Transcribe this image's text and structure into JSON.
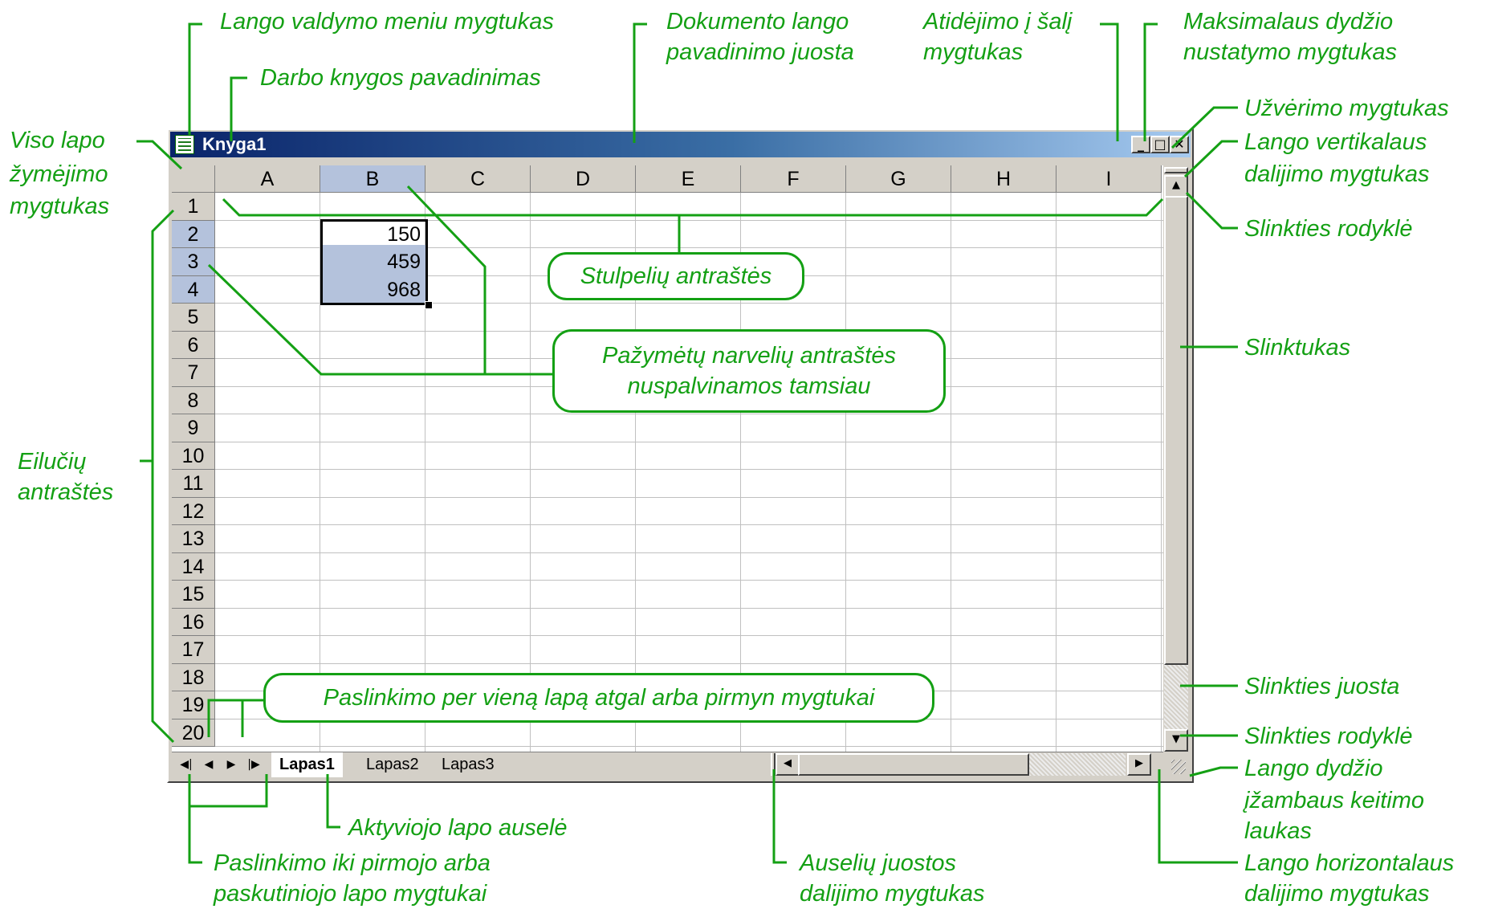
{
  "window": {
    "title": "Knyga1",
    "minimize_glyph": "_",
    "maximize_glyph": "□",
    "close_glyph": "✕"
  },
  "grid": {
    "columns": [
      "A",
      "B",
      "C",
      "D",
      "E",
      "F",
      "G",
      "H",
      "I"
    ],
    "selected_column": "B",
    "rows": [
      "1",
      "2",
      "3",
      "4",
      "5",
      "6",
      "7",
      "8",
      "9",
      "10",
      "11",
      "12",
      "13",
      "14",
      "15",
      "16",
      "17",
      "18",
      "19",
      "20"
    ],
    "selected_rows": [
      "2",
      "3",
      "4"
    ],
    "cells": [
      {
        "col": "B",
        "row": "2",
        "value": "150"
      },
      {
        "col": "B",
        "row": "3",
        "value": "459"
      },
      {
        "col": "B",
        "row": "4",
        "value": "968"
      }
    ]
  },
  "sheets": {
    "tabs": [
      "Lapas1",
      "Lapas2",
      "Lapas3"
    ],
    "active": "Lapas1",
    "nav": {
      "first": "◀|",
      "prev": "◀",
      "next": "▶",
      "last": "|▶"
    }
  },
  "scroll": {
    "up": "▲",
    "down": "▼",
    "left": "◀",
    "right": "▶"
  },
  "annotations": {
    "window_menu_button": "Lango valdymo meniu mygtukas",
    "workbook_name": "Darbo knygos pavadinimas",
    "doc_title_bar": [
      "Dokumento lango",
      "pavadinimo juosta"
    ],
    "minimize_button": [
      "Atidėjimo į šalį",
      "mygtukas"
    ],
    "maximize_button": [
      "Maksimalaus dydžio",
      "nustatymo mygtukas"
    ],
    "close_button": "Užvėrimo mygtukas",
    "vsplit_button": [
      "Lango vertikalaus",
      "dalijimo mygtukas"
    ],
    "scroll_arrow_top": "Slinkties rodyklė",
    "select_all": [
      "Viso lapo",
      "žymėjimo",
      "mygtukas"
    ],
    "column_headers": "Stulpelių antraštės",
    "selected_headers": [
      "Pažymėtų narvelių antraštės",
      "nuspalvinamos tamsiau"
    ],
    "scroll_thumb": "Slinktukas",
    "row_headers": [
      "Eilučių",
      "antraštės"
    ],
    "scroll_bar": "Slinkties juosta",
    "nav_one_sheet": "Paslinkimo per vieną lapą atgal arba pirmyn mygtukai",
    "scroll_arrow_bottom": "Slinkties rodyklė",
    "resize_box": [
      "Lango dydžio",
      "įžambaus keitimo",
      "laukas"
    ],
    "active_tab": "Aktyviojo lapo auselė",
    "nav_first_last": [
      "Paslinkimo iki pirmojo arba",
      "paskutiniojo lapo mygtukai"
    ],
    "tab_split": [
      "Auselių juostos",
      "dalijimo mygtukas"
    ],
    "hsplit_button": [
      "Lango horizontalaus",
      "dalijimo mygtukas"
    ]
  },
  "colors": {
    "annotation": "#14a014",
    "title_bar_start": "#0a246a",
    "title_bar_end": "#a6caf0",
    "selection_header": "#b4c2dc"
  }
}
